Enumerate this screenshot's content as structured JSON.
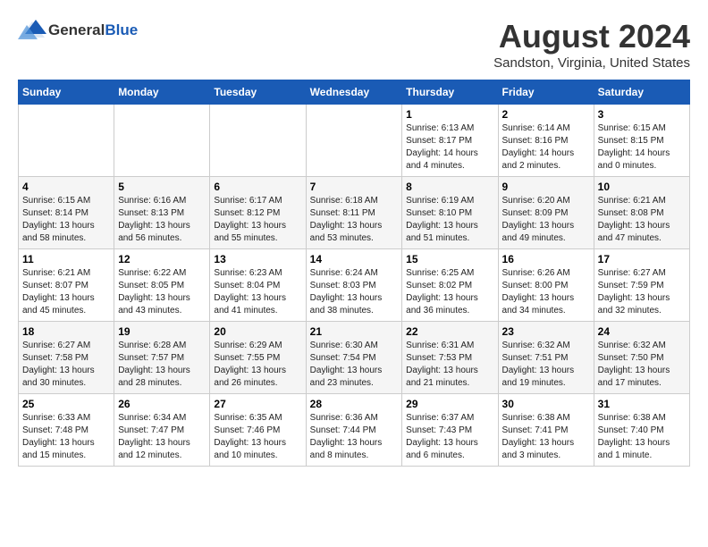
{
  "header": {
    "logo_general": "General",
    "logo_blue": "Blue",
    "month_title": "August 2024",
    "location": "Sandston, Virginia, United States"
  },
  "weekdays": [
    "Sunday",
    "Monday",
    "Tuesday",
    "Wednesday",
    "Thursday",
    "Friday",
    "Saturday"
  ],
  "weeks": [
    [
      {
        "day": "",
        "info": ""
      },
      {
        "day": "",
        "info": ""
      },
      {
        "day": "",
        "info": ""
      },
      {
        "day": "",
        "info": ""
      },
      {
        "day": "1",
        "info": "Sunrise: 6:13 AM\nSunset: 8:17 PM\nDaylight: 14 hours\nand 4 minutes."
      },
      {
        "day": "2",
        "info": "Sunrise: 6:14 AM\nSunset: 8:16 PM\nDaylight: 14 hours\nand 2 minutes."
      },
      {
        "day": "3",
        "info": "Sunrise: 6:15 AM\nSunset: 8:15 PM\nDaylight: 14 hours\nand 0 minutes."
      }
    ],
    [
      {
        "day": "4",
        "info": "Sunrise: 6:15 AM\nSunset: 8:14 PM\nDaylight: 13 hours\nand 58 minutes."
      },
      {
        "day": "5",
        "info": "Sunrise: 6:16 AM\nSunset: 8:13 PM\nDaylight: 13 hours\nand 56 minutes."
      },
      {
        "day": "6",
        "info": "Sunrise: 6:17 AM\nSunset: 8:12 PM\nDaylight: 13 hours\nand 55 minutes."
      },
      {
        "day": "7",
        "info": "Sunrise: 6:18 AM\nSunset: 8:11 PM\nDaylight: 13 hours\nand 53 minutes."
      },
      {
        "day": "8",
        "info": "Sunrise: 6:19 AM\nSunset: 8:10 PM\nDaylight: 13 hours\nand 51 minutes."
      },
      {
        "day": "9",
        "info": "Sunrise: 6:20 AM\nSunset: 8:09 PM\nDaylight: 13 hours\nand 49 minutes."
      },
      {
        "day": "10",
        "info": "Sunrise: 6:21 AM\nSunset: 8:08 PM\nDaylight: 13 hours\nand 47 minutes."
      }
    ],
    [
      {
        "day": "11",
        "info": "Sunrise: 6:21 AM\nSunset: 8:07 PM\nDaylight: 13 hours\nand 45 minutes."
      },
      {
        "day": "12",
        "info": "Sunrise: 6:22 AM\nSunset: 8:05 PM\nDaylight: 13 hours\nand 43 minutes."
      },
      {
        "day": "13",
        "info": "Sunrise: 6:23 AM\nSunset: 8:04 PM\nDaylight: 13 hours\nand 41 minutes."
      },
      {
        "day": "14",
        "info": "Sunrise: 6:24 AM\nSunset: 8:03 PM\nDaylight: 13 hours\nand 38 minutes."
      },
      {
        "day": "15",
        "info": "Sunrise: 6:25 AM\nSunset: 8:02 PM\nDaylight: 13 hours\nand 36 minutes."
      },
      {
        "day": "16",
        "info": "Sunrise: 6:26 AM\nSunset: 8:00 PM\nDaylight: 13 hours\nand 34 minutes."
      },
      {
        "day": "17",
        "info": "Sunrise: 6:27 AM\nSunset: 7:59 PM\nDaylight: 13 hours\nand 32 minutes."
      }
    ],
    [
      {
        "day": "18",
        "info": "Sunrise: 6:27 AM\nSunset: 7:58 PM\nDaylight: 13 hours\nand 30 minutes."
      },
      {
        "day": "19",
        "info": "Sunrise: 6:28 AM\nSunset: 7:57 PM\nDaylight: 13 hours\nand 28 minutes."
      },
      {
        "day": "20",
        "info": "Sunrise: 6:29 AM\nSunset: 7:55 PM\nDaylight: 13 hours\nand 26 minutes."
      },
      {
        "day": "21",
        "info": "Sunrise: 6:30 AM\nSunset: 7:54 PM\nDaylight: 13 hours\nand 23 minutes."
      },
      {
        "day": "22",
        "info": "Sunrise: 6:31 AM\nSunset: 7:53 PM\nDaylight: 13 hours\nand 21 minutes."
      },
      {
        "day": "23",
        "info": "Sunrise: 6:32 AM\nSunset: 7:51 PM\nDaylight: 13 hours\nand 19 minutes."
      },
      {
        "day": "24",
        "info": "Sunrise: 6:32 AM\nSunset: 7:50 PM\nDaylight: 13 hours\nand 17 minutes."
      }
    ],
    [
      {
        "day": "25",
        "info": "Sunrise: 6:33 AM\nSunset: 7:48 PM\nDaylight: 13 hours\nand 15 minutes."
      },
      {
        "day": "26",
        "info": "Sunrise: 6:34 AM\nSunset: 7:47 PM\nDaylight: 13 hours\nand 12 minutes."
      },
      {
        "day": "27",
        "info": "Sunrise: 6:35 AM\nSunset: 7:46 PM\nDaylight: 13 hours\nand 10 minutes."
      },
      {
        "day": "28",
        "info": "Sunrise: 6:36 AM\nSunset: 7:44 PM\nDaylight: 13 hours\nand 8 minutes."
      },
      {
        "day": "29",
        "info": "Sunrise: 6:37 AM\nSunset: 7:43 PM\nDaylight: 13 hours\nand 6 minutes."
      },
      {
        "day": "30",
        "info": "Sunrise: 6:38 AM\nSunset: 7:41 PM\nDaylight: 13 hours\nand 3 minutes."
      },
      {
        "day": "31",
        "info": "Sunrise: 6:38 AM\nSunset: 7:40 PM\nDaylight: 13 hours\nand 1 minute."
      }
    ]
  ]
}
